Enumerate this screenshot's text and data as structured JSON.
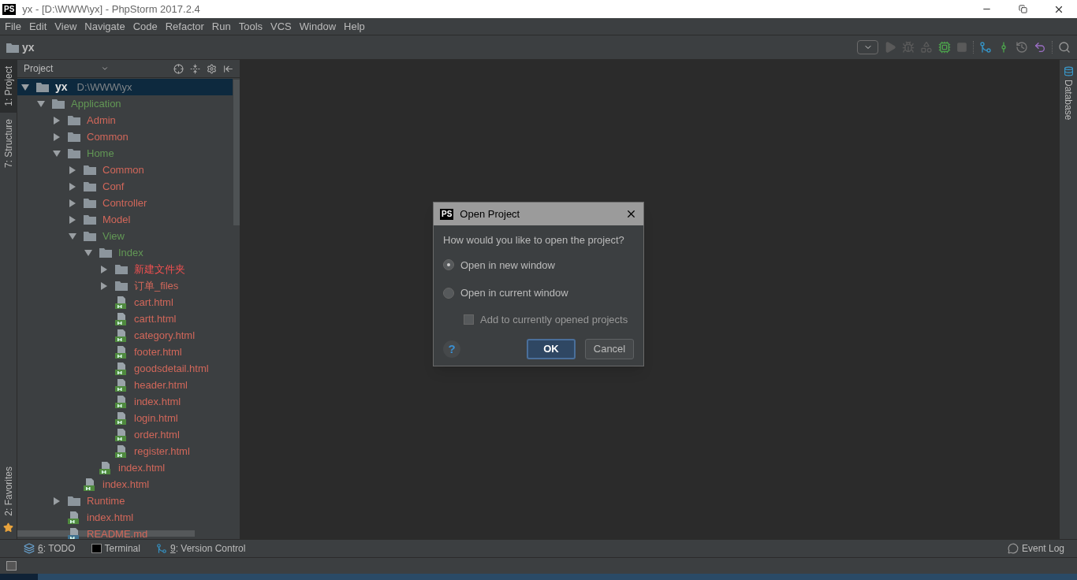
{
  "window": {
    "title": "yx - [D:\\WWW\\yx] - PhpStorm 2017.2.4",
    "logo": "PS"
  },
  "menu": [
    "File",
    "Edit",
    "View",
    "Navigate",
    "Code",
    "Refactor",
    "Run",
    "Tools",
    "VCS",
    "Window",
    "Help"
  ],
  "breadcrumb": [
    "yx"
  ],
  "left_stripe": {
    "top": [
      {
        "label": "1: Project",
        "selected": true
      },
      {
        "label": "7: Structure",
        "selected": false
      }
    ],
    "bottom": [
      {
        "label": "2: Favorites",
        "selected": false
      }
    ]
  },
  "right_stripe": [
    {
      "label": "Database",
      "selected": false
    }
  ],
  "project_panel": {
    "title": "Project"
  },
  "tree": [
    {
      "name": "yx",
      "path": "D:\\WWW\\yx",
      "kind": "folder",
      "expanded": true,
      "selected": true,
      "children": [
        {
          "name": "Application",
          "kind": "folder",
          "expanded": true,
          "selected": false,
          "color": "#629755",
          "children": [
            {
              "name": "Admin",
              "kind": "folder",
              "expanded": false,
              "selected": false,
              "color": "#d1675a"
            },
            {
              "name": "Common",
              "kind": "folder",
              "expanded": false,
              "selected": false,
              "color": "#d1675a"
            },
            {
              "name": "Home",
              "kind": "folder",
              "expanded": true,
              "selected": false,
              "color": "#629755",
              "children": [
                {
                  "name": "Common",
                  "kind": "folder",
                  "expanded": false,
                  "selected": false,
                  "color": "#d1675a"
                },
                {
                  "name": "Conf",
                  "kind": "folder",
                  "expanded": false,
                  "selected": false,
                  "color": "#d1675a"
                },
                {
                  "name": "Controller",
                  "kind": "folder",
                  "expanded": false,
                  "selected": false,
                  "color": "#d1675a"
                },
                {
                  "name": "Model",
                  "kind": "folder",
                  "expanded": false,
                  "selected": false,
                  "color": "#d1675a"
                },
                {
                  "name": "View",
                  "kind": "folder",
                  "expanded": true,
                  "selected": false,
                  "color": "#629755",
                  "children": [
                    {
                      "name": "Index",
                      "kind": "folder",
                      "expanded": true,
                      "selected": false,
                      "color": "#629755",
                      "children": [
                        {
                          "name": "新建文件夹",
                          "kind": "folder",
                          "expanded": false,
                          "selected": false,
                          "color": "#f05050"
                        },
                        {
                          "name": "订单_files",
                          "kind": "folder",
                          "expanded": false,
                          "selected": false,
                          "color": "#d1675a"
                        },
                        {
                          "name": "cart.html",
                          "kind": "html",
                          "selected": false,
                          "color": "#d1675a"
                        },
                        {
                          "name": "cartt.html",
                          "kind": "html",
                          "selected": false,
                          "color": "#d1675a"
                        },
                        {
                          "name": "category.html",
                          "kind": "html",
                          "selected": false,
                          "color": "#d1675a"
                        },
                        {
                          "name": "footer.html",
                          "kind": "html",
                          "selected": false,
                          "color": "#d1675a"
                        },
                        {
                          "name": "goodsdetail.html",
                          "kind": "html",
                          "selected": false,
                          "color": "#d1675a"
                        },
                        {
                          "name": "header.html",
                          "kind": "html",
                          "selected": false,
                          "color": "#d1675a"
                        },
                        {
                          "name": "index.html",
                          "kind": "html",
                          "selected": false,
                          "color": "#d1675a"
                        },
                        {
                          "name": "login.html",
                          "kind": "html",
                          "selected": false,
                          "color": "#d1675a"
                        },
                        {
                          "name": "order.html",
                          "kind": "html",
                          "selected": false,
                          "color": "#d1675a"
                        },
                        {
                          "name": "register.html",
                          "kind": "html",
                          "selected": false,
                          "color": "#d1675a"
                        }
                      ]
                    },
                    {
                      "name": "index.html",
                      "kind": "html",
                      "selected": false,
                      "color": "#d1675a"
                    }
                  ]
                },
                {
                  "name": "index.html",
                  "kind": "html",
                  "selected": false,
                  "color": "#d1675a"
                }
              ]
            },
            {
              "name": "Runtime",
              "kind": "folder",
              "expanded": false,
              "selected": false,
              "color": "#d1675a"
            },
            {
              "name": "index.html",
              "kind": "html",
              "selected": false,
              "color": "#d1675a"
            },
            {
              "name": "README.md",
              "kind": "md",
              "selected": false,
              "color": "#d1675a"
            }
          ]
        }
      ]
    }
  ],
  "bottom_tools": [
    {
      "number": "6",
      "label": ": TODO",
      "kind": "todo"
    },
    {
      "label": "Terminal",
      "kind": "terminal"
    },
    {
      "number": "9",
      "label": ": Version Control",
      "kind": "vcs"
    }
  ],
  "event_log": "Event Log",
  "dialog": {
    "title": "Open Project",
    "logo": "PS",
    "question": "How would you like to open the project?",
    "options": [
      {
        "label": "Open in new window",
        "selected": true
      },
      {
        "label": "Open in current window",
        "selected": false
      }
    ],
    "checkbox": {
      "label": "Add to currently opened projects",
      "checked": false
    },
    "help": "?",
    "buttons": [
      {
        "label": "OK",
        "kind": "default"
      },
      {
        "label": "Cancel",
        "kind": "normal"
      }
    ]
  }
}
